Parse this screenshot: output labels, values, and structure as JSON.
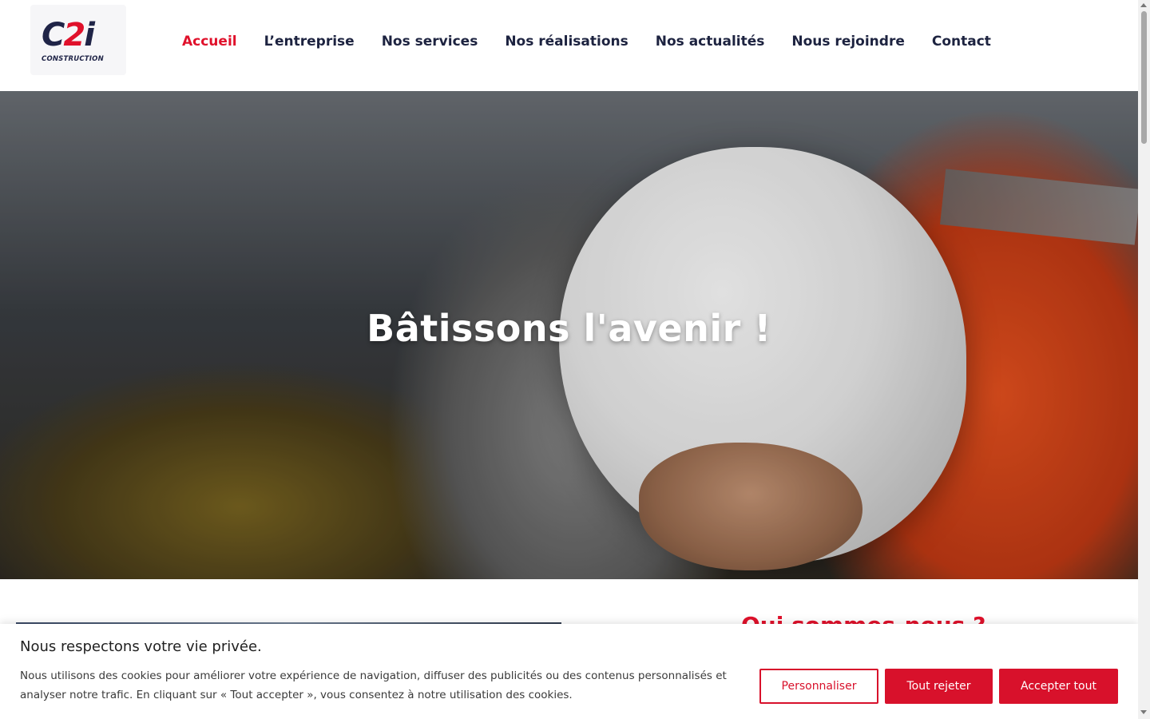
{
  "logo": {
    "mark_left": "C",
    "mark_mid": "2",
    "mark_right": "i",
    "subtitle": "CONSTRUCTION"
  },
  "nav": {
    "items": [
      {
        "label": "Accueil",
        "active": true
      },
      {
        "label": "L’entreprise",
        "active": false
      },
      {
        "label": "Nos services",
        "active": false
      },
      {
        "label": "Nos réalisations",
        "active": false
      },
      {
        "label": "Nos actualités",
        "active": false
      },
      {
        "label": "Nous rejoindre",
        "active": false
      },
      {
        "label": "Contact",
        "active": false
      }
    ]
  },
  "hero": {
    "title": "Bâtissons l'avenir !"
  },
  "section": {
    "title": "Qui sommes-nous ?"
  },
  "cookie": {
    "title": "Nous respectons votre vie privée.",
    "text": "Nous utilisons des cookies pour améliorer votre expérience de navigation, diffuser des publicités ou des contenus personnalisés et analyser notre trafic. En cliquant sur « Tout accepter », vous consentez à notre utilisation des cookies.",
    "customize_label": "Personnaliser",
    "reject_label": "Tout rejeter",
    "accept_label": "Accepter tout"
  },
  "colors": {
    "brand_red": "#e0112b",
    "navy": "#1d2340",
    "button_red": "#d8112b"
  }
}
